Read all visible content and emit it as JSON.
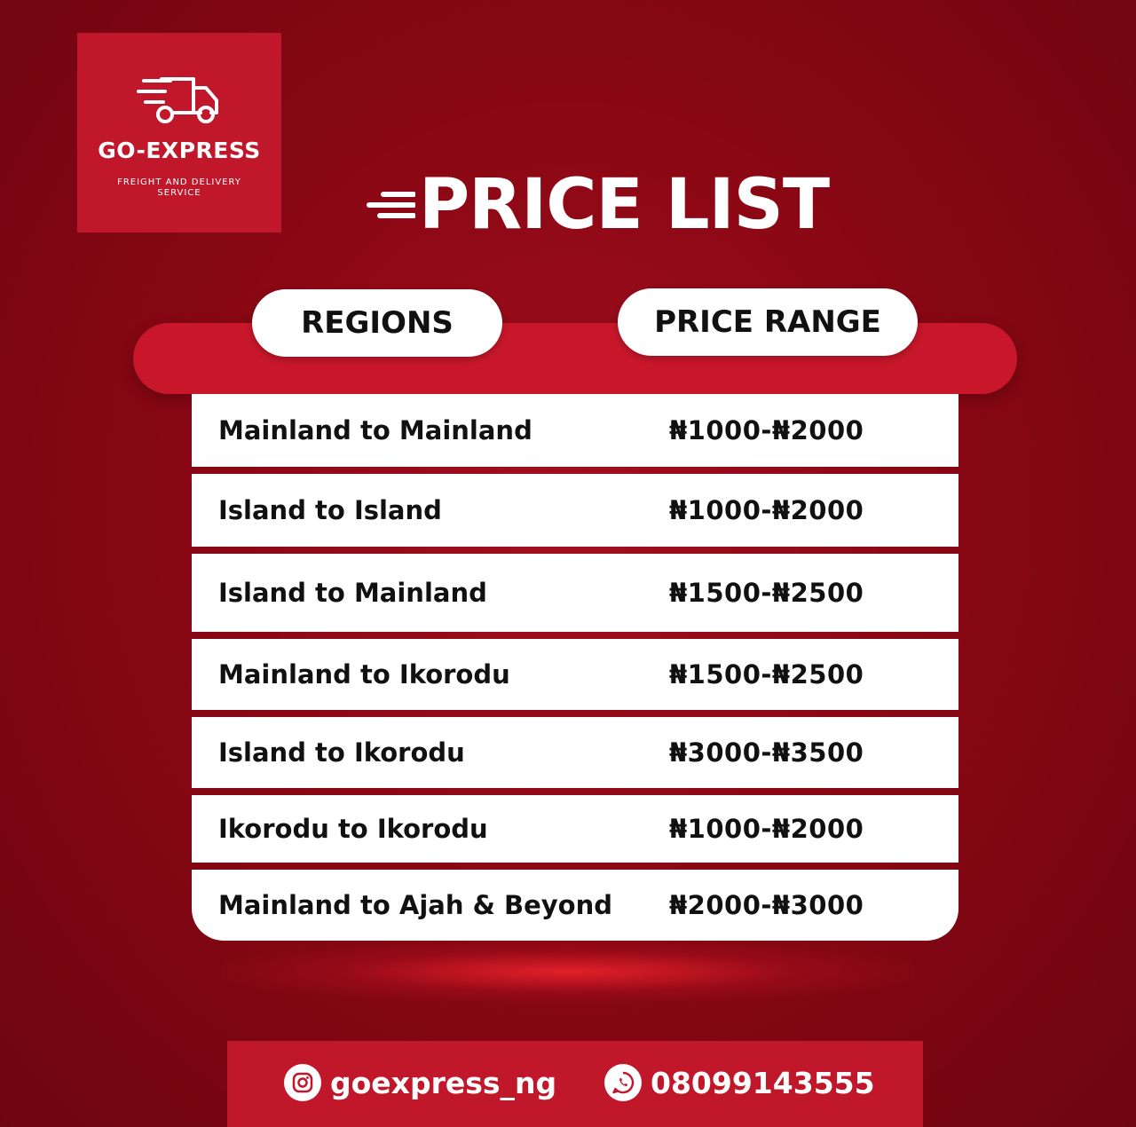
{
  "brand": {
    "name": "GO-EXPRESS",
    "tagline_line1": "FREIGHT AND DELIVERY",
    "tagline_line2": "SERVICE",
    "icon": "delivery-truck-icon"
  },
  "title": "PRICE LIST",
  "headers": {
    "regions": "REGIONS",
    "price_range": "PRICE RANGE"
  },
  "rows": [
    {
      "region": "Mainland to Mainland",
      "price": "₦1000-₦2000"
    },
    {
      "region": "Island to Island",
      "price": "₦1000-₦2000"
    },
    {
      "region": "Island to Mainland",
      "price": "₦1500-₦2500"
    },
    {
      "region": "Mainland to Ikorodu",
      "price": "₦1500-₦2500"
    },
    {
      "region": "Island to Ikorodu",
      "price": "₦3000-₦3500"
    },
    {
      "region": "Ikorodu to Ikorodu",
      "price": "₦1000-₦2000"
    },
    {
      "region": "Mainland to Ajah & Beyond",
      "price": "₦2000-₦3000"
    }
  ],
  "footer": {
    "instagram": {
      "icon": "instagram-icon",
      "handle": "goexpress_ng"
    },
    "whatsapp": {
      "icon": "whatsapp-icon",
      "number": "08099143555"
    }
  },
  "colors": {
    "background": "#8a0714",
    "accent": "#c0182a",
    "row_bg": "#ffffff",
    "text_dark": "#111111"
  }
}
